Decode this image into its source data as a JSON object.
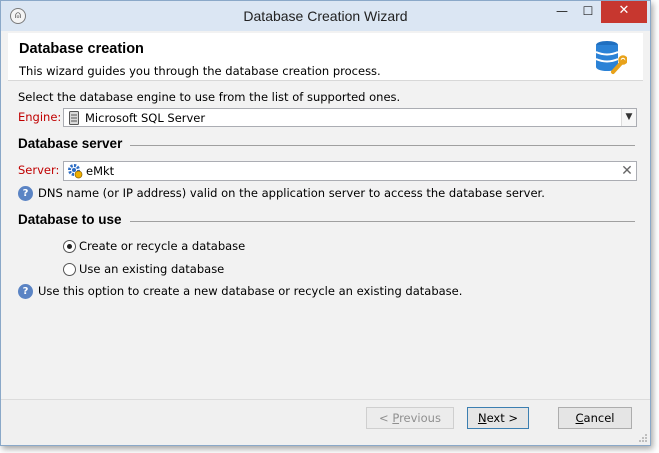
{
  "window": {
    "title": "Database Creation Wizard",
    "app_icon_glyph": "⍝",
    "min_glyph": "—",
    "max_glyph": "☐",
    "close_glyph": "✕"
  },
  "header": {
    "title": "Database creation",
    "subtitle": "This wizard guides you through the database creation process.",
    "icon": "database-wrench-icon"
  },
  "engine": {
    "prompt": "Select the database engine to use from the list of supported ones.",
    "label": "Engine:",
    "value": "Microsoft SQL Server",
    "icon": "server-icon"
  },
  "database_server": {
    "section_title": "Database server",
    "label": "Server:",
    "value": "eMkt",
    "help_text": "DNS name (or IP address) valid on the application server to access the database server."
  },
  "database_to_use": {
    "section_title": "Database to use",
    "options": [
      {
        "label": "Create or recycle a database",
        "checked": true
      },
      {
        "label": "Use an existing database",
        "checked": false
      }
    ],
    "help_text": "Use this option to create a new database or recycle an existing database."
  },
  "buttons": {
    "previous_arrow": "< ",
    "previous_key": "P",
    "previous_rest": "revious",
    "next_key": "N",
    "next_rest": "ext >",
    "cancel_key": "C",
    "cancel_rest": "ancel"
  },
  "colors": {
    "label_red": "#c00000",
    "help_blue": "#5b84c4",
    "titlebar": "#dbe6f3",
    "close_red": "#c7372f"
  }
}
